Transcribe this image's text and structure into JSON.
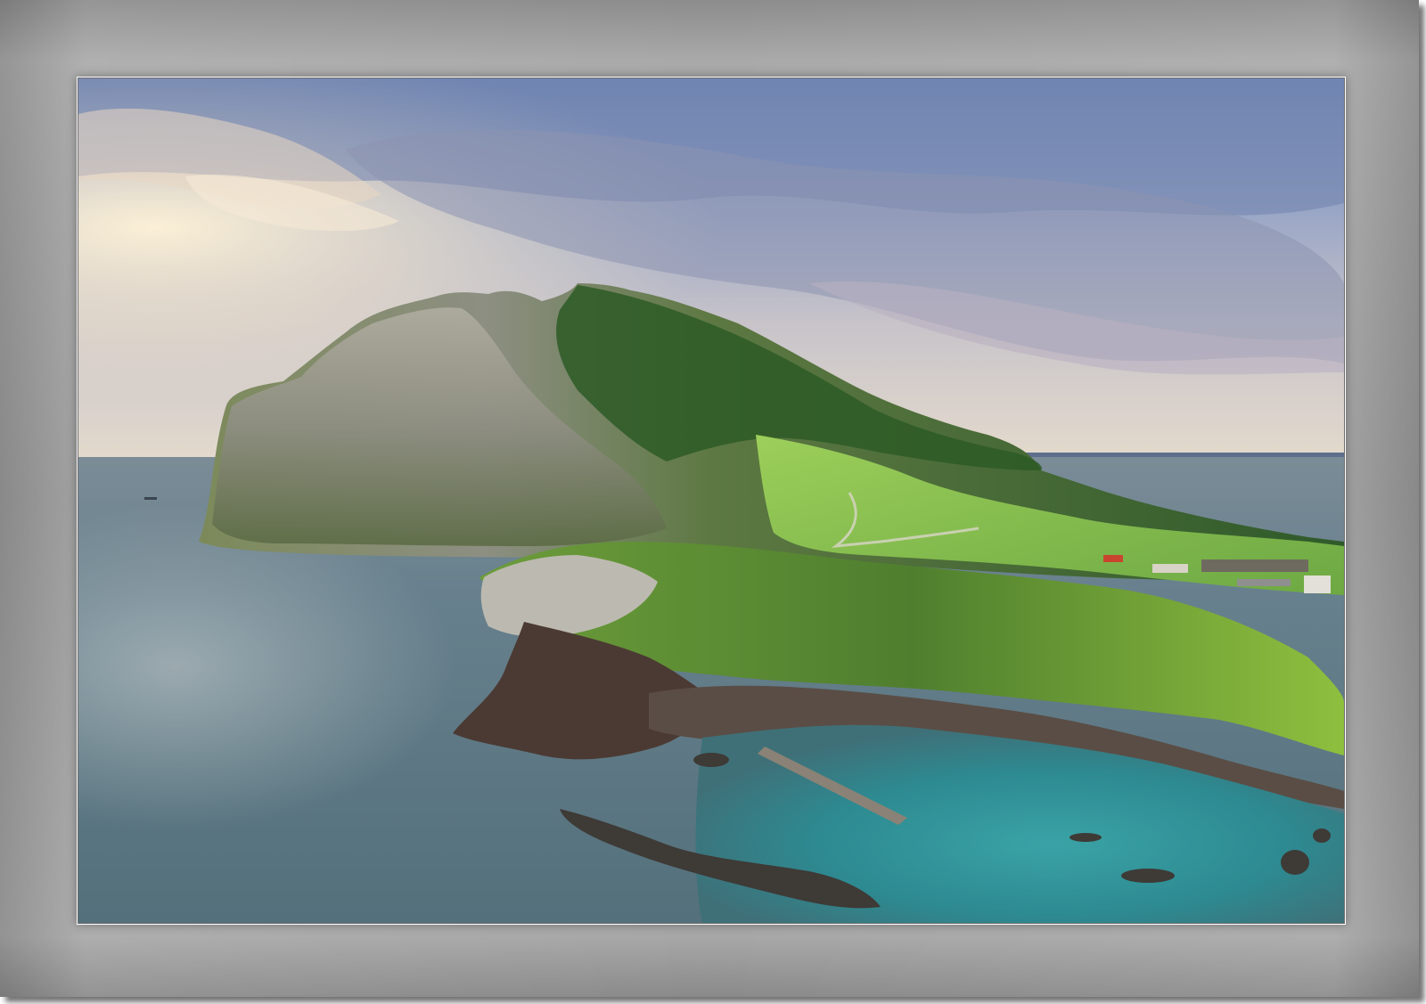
{
  "image": {
    "subject": "coastal-headland-landscape",
    "colors": {
      "frame": "#9c9c9c",
      "sky_top": "#6a87b8",
      "sky_glow": "#f3e6cf",
      "sea": "#5d7683",
      "lagoon": "#2f8d95",
      "grass": "#7fbf4a",
      "cliff": "#8c8f7c"
    }
  }
}
